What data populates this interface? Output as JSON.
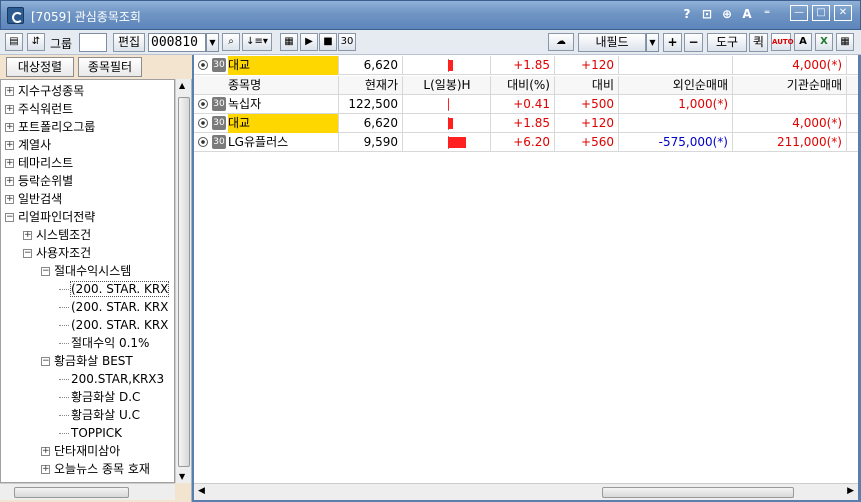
{
  "window": {
    "title": "[7059] 관심종목조회",
    "tools": [
      "?",
      "⊡",
      "⊕",
      "A",
      "⁼"
    ],
    "min": "—",
    "max": "□",
    "close": "✕"
  },
  "toolbar": {
    "group_label": "그룹",
    "group_value": "",
    "edit_label": "편집",
    "code_value": "000810",
    "sort_label": "⇵",
    "play": "▶",
    "stop": "■",
    "interval": "30",
    "field_select": "내필드",
    "plus": "+",
    "minus": "−",
    "tools_label": "도구",
    "quote_label": "퀵",
    "auto_label": "AUTO",
    "font_label": "A"
  },
  "sidebar": {
    "tabs": [
      "대상정렬",
      "종목필터"
    ],
    "tree": [
      {
        "label": "지수구성종목",
        "level": 0,
        "type": "plus"
      },
      {
        "label": "주식워런트",
        "level": 0,
        "type": "plus"
      },
      {
        "label": "포트폴리오그룹",
        "level": 0,
        "type": "plus"
      },
      {
        "label": "계열사",
        "level": 0,
        "type": "plus"
      },
      {
        "label": "테마리스트",
        "level": 0,
        "type": "plus"
      },
      {
        "label": "등락순위별",
        "level": 0,
        "type": "plus"
      },
      {
        "label": "일반검색",
        "level": 0,
        "type": "plus"
      },
      {
        "label": "리얼파인더전략",
        "level": 0,
        "type": "minus"
      },
      {
        "label": "시스템조건",
        "level": 1,
        "type": "plus"
      },
      {
        "label": "사용자조건",
        "level": 1,
        "type": "minus"
      },
      {
        "label": "절대수익시스템",
        "level": 2,
        "type": "minus"
      },
      {
        "label": "(200. STAR. KRX",
        "level": 3,
        "type": "leaf",
        "selected": true
      },
      {
        "label": "(200. STAR. KRX",
        "level": 3,
        "type": "leaf"
      },
      {
        "label": "(200. STAR. KRX",
        "level": 3,
        "type": "leaf"
      },
      {
        "label": "절대수익 0.1%",
        "level": 3,
        "type": "leaf"
      },
      {
        "label": "황금화살 BEST",
        "level": 2,
        "type": "minus"
      },
      {
        "label": "200.STAR,KRX3",
        "level": 3,
        "type": "leaf"
      },
      {
        "label": "황금화살 D.C",
        "level": 3,
        "type": "leaf"
      },
      {
        "label": "황금화살 U.C",
        "level": 3,
        "type": "leaf"
      },
      {
        "label": "TOPPICK",
        "level": 3,
        "type": "leaf"
      },
      {
        "label": "단타재미삼아",
        "level": 2,
        "type": "plus"
      },
      {
        "label": "오늘뉴스 종목 호재",
        "level": 2,
        "type": "plus"
      }
    ]
  },
  "grid": {
    "badge": "30",
    "headers": [
      "종목명",
      "현재가",
      "L(일봉)H",
      "대비(%)",
      "대비",
      "외인순매매",
      "기관순매매"
    ],
    "top_row": {
      "name": "대교",
      "price": "6,620",
      "bar": 0.3,
      "pct": "+1.85",
      "chg": "+120",
      "foreign": "",
      "inst": "4,000(*)"
    },
    "rows": [
      {
        "name": "녹십자",
        "price": "122,500",
        "bar": 0.05,
        "pct": "+0.41",
        "chg": "+500",
        "foreign": "1,000(*)",
        "foreign_color": "#e00000",
        "inst": "",
        "highlight": false
      },
      {
        "name": "대교",
        "price": "6,620",
        "bar": 0.3,
        "pct": "+1.85",
        "chg": "+120",
        "foreign": "",
        "foreign_color": "#e00000",
        "inst": "4,000(*)",
        "highlight": true
      },
      {
        "name": "LG유플러스",
        "price": "9,590",
        "bar": 1.0,
        "pct": "+6.20",
        "chg": "+560",
        "foreign": "-575,000(*)",
        "foreign_color": "#0000c8",
        "inst": "211,000(*)",
        "highlight": false
      }
    ],
    "colors": {
      "up": "#e00000",
      "down": "#0000c8",
      "highlight": "#ffd700"
    }
  }
}
